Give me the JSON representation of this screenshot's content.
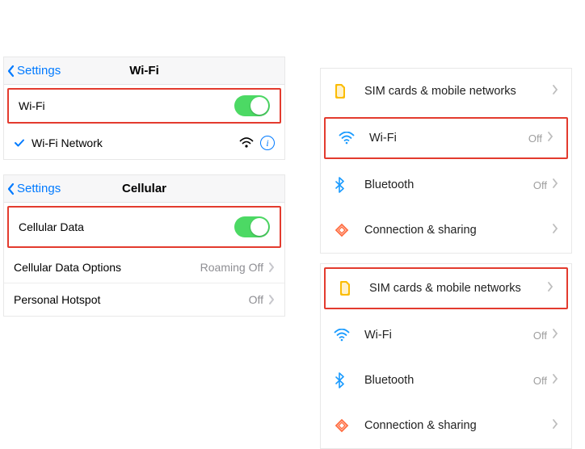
{
  "ios_wifi": {
    "back_label": "Settings",
    "title": "Wi-Fi",
    "toggle_row_label": "Wi-Fi",
    "network_row_label": "Wi-Fi Network"
  },
  "ios_cell": {
    "back_label": "Settings",
    "title": "Cellular",
    "toggle_row_label": "Cellular Data",
    "options_label": "Cellular Data Options",
    "options_value": "Roaming Off",
    "hotspot_label": "Personal Hotspot",
    "hotspot_value": "Off"
  },
  "android_a": {
    "sim_label": "SIM cards & mobile networks",
    "wifi_label": "Wi-Fi",
    "wifi_value": "Off",
    "bt_label": "Bluetooth",
    "bt_value": "Off",
    "share_label": "Connection & sharing"
  },
  "android_b": {
    "sim_label": "SIM cards & mobile networks",
    "wifi_label": "Wi-Fi",
    "wifi_value": "Off",
    "bt_label": "Bluetooth",
    "bt_value": "Off",
    "share_label": "Connection & sharing"
  }
}
